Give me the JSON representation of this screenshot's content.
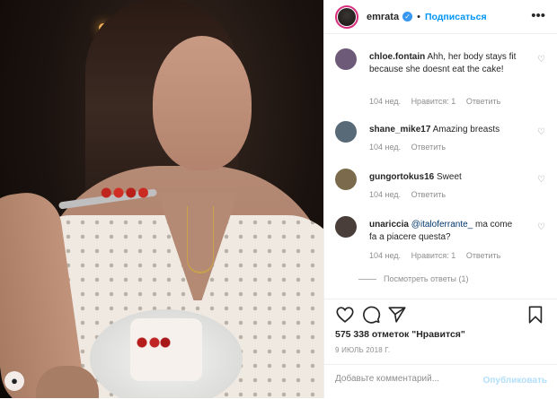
{
  "header": {
    "username": "emrata",
    "dot": "•",
    "follow_label": "Подписаться",
    "more_label": "•••"
  },
  "comments": [
    {
      "username": "chloe.fontain",
      "text": "Ahh, her body stays fit because she doesnt eat the cake!",
      "time": "104 нед.",
      "likes": "Нравится: 1",
      "reply": "Ответить",
      "avatar_color": "#6d5a78"
    },
    {
      "username": "shane_mike17",
      "text": "Amazing breasts",
      "time": "104 нед.",
      "reply": "Ответить",
      "avatar_color": "#586a78"
    },
    {
      "username": "gungortokus16",
      "text": "Sweet",
      "time": "104 нед.",
      "reply": "Ответить",
      "avatar_color": "#7c6a4c"
    },
    {
      "username": "unariccia",
      "mention": "@italoferrante_",
      "text": "ma come fa a piacere questa?",
      "time": "104 нед.",
      "likes": "Нравится: 1",
      "reply": "Ответить",
      "avatar_color": "#4a3e3a",
      "view_replies": "Посмотреть ответы (1)"
    }
  ],
  "post": {
    "likes_text": "575 338 отметок \"Нравится\"",
    "date": "9 ИЮЛЬ 2018 Г."
  },
  "comment_box": {
    "placeholder": "Добавьте комментарий...",
    "publish_label": "Опубликовать"
  },
  "colors": {
    "accent": "#0095f6",
    "verified": "#3897f0",
    "story_ring": "#d72d7d",
    "publish_disabled": "#b2dffc"
  },
  "icons": [
    "heart-icon",
    "comment-icon",
    "share-icon",
    "bookmark-icon",
    "verified-icon",
    "more-icon"
  ]
}
